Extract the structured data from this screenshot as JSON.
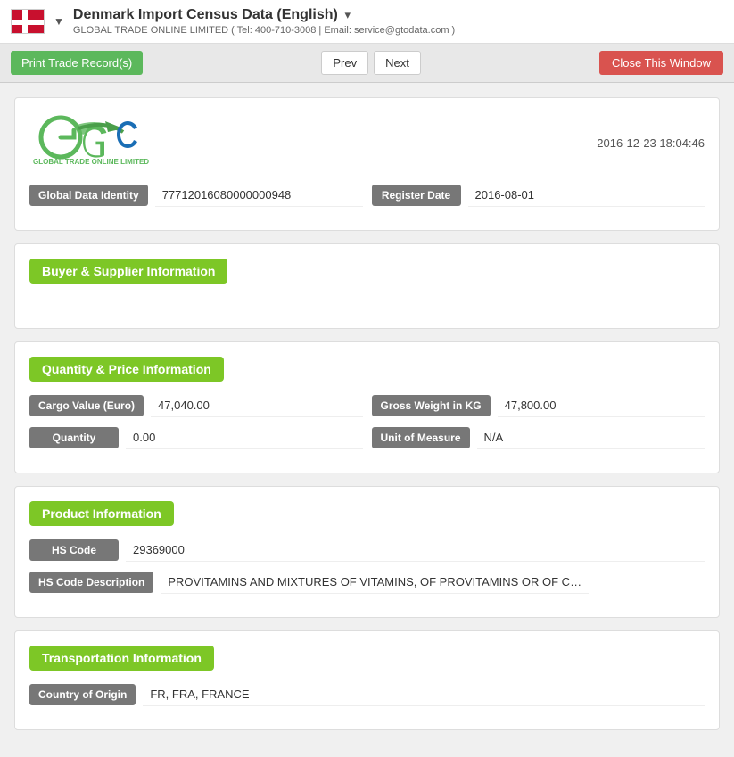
{
  "header": {
    "title": "Denmark Import Census Data (English)",
    "title_suffix": "▾",
    "company": "GLOBAL TRADE ONLINE LIMITED ( Tel: 400-710-3008 | Email: service@gtodata.com )"
  },
  "toolbar": {
    "print_label": "Print Trade Record(s)",
    "prev_label": "Prev",
    "next_label": "Next",
    "close_label": "Close This Window"
  },
  "record_info": {
    "timestamp": "2016-12-23 18:04:46",
    "global_data_identity_label": "Global Data Identity",
    "global_data_identity_value": "77712016080000000948",
    "register_date_label": "Register Date",
    "register_date_value": "2016-08-01"
  },
  "sections": {
    "buyer_supplier": {
      "title": "Buyer & Supplier Information"
    },
    "quantity_price": {
      "title": "Quantity & Price Information",
      "cargo_value_label": "Cargo Value (Euro)",
      "cargo_value": "47,040.00",
      "gross_weight_label": "Gross Weight in KG",
      "gross_weight": "47,800.00",
      "quantity_label": "Quantity",
      "quantity_value": "0.00",
      "unit_of_measure_label": "Unit of Measure",
      "unit_of_measure_value": "N/A"
    },
    "product": {
      "title": "Product Information",
      "hs_code_label": "HS Code",
      "hs_code_value": "29369000",
      "hs_code_desc_label": "HS Code Description",
      "hs_code_desc_value": "PROVITAMINS AND MIXTURES OF VITAMINS, OF PROVITAMINS OR OF CONCENTRATES, WH"
    },
    "transportation": {
      "title": "Transportation Information",
      "country_of_origin_label": "Country of Origin",
      "country_of_origin_value": "FR, FRA, FRANCE"
    }
  }
}
